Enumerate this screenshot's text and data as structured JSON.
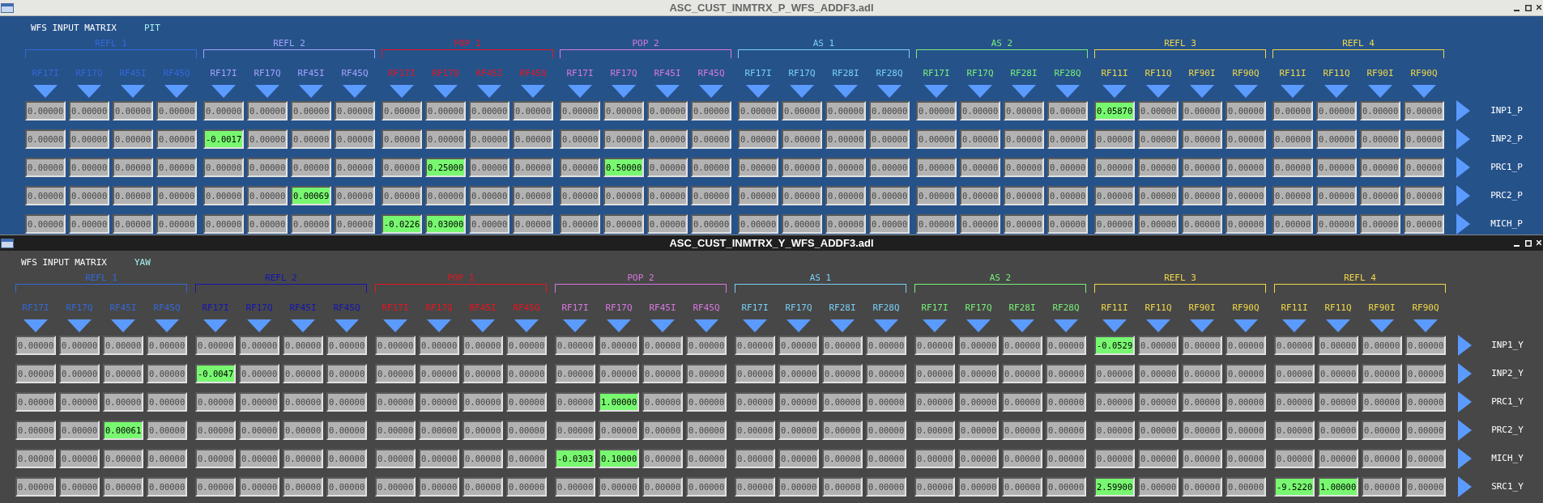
{
  "windows": [
    {
      "title": "ASC_CUST_INMTRX_P_WFS_ADDF3.adl",
      "heading": "WFS INPUT MATRIX",
      "mode": "PIT",
      "groups": [
        {
          "name": "REFL 1",
          "color": "#3468d8",
          "channels": [
            "RF17I",
            "RF17Q",
            "RF45I",
            "RF45Q"
          ]
        },
        {
          "name": "REFL 2",
          "color": "#a4a4ff",
          "channels": [
            "RF17I",
            "RF17Q",
            "RF45I",
            "RF45Q"
          ]
        },
        {
          "name": "POP 1",
          "color": "#e81420",
          "channels": [
            "RF17I",
            "RF17Q",
            "RF45I",
            "RF45Q"
          ]
        },
        {
          "name": "POP 2",
          "color": "#d878e0",
          "channels": [
            "RF17I",
            "RF17Q",
            "RF45I",
            "RF45Q"
          ]
        },
        {
          "name": "AS 1",
          "color": "#78d0f8",
          "channels": [
            "RF17I",
            "RF17Q",
            "RF28I",
            "RF28Q"
          ]
        },
        {
          "name": "AS 2",
          "color": "#78f078",
          "channels": [
            "RF17I",
            "RF17Q",
            "RF28I",
            "RF28Q"
          ]
        },
        {
          "name": "REFL 3",
          "color": "#f0d848",
          "channels": [
            "RF11I",
            "RF11Q",
            "RF90I",
            "RF90Q"
          ]
        },
        {
          "name": "REFL 4",
          "color": "#f0d848",
          "channels": [
            "RF11I",
            "RF11Q",
            "RF90I",
            "RF90Q"
          ]
        }
      ],
      "rows": [
        {
          "label": "INP1_P",
          "cells": [
            {
              "value": "0.00000",
              "on": false
            },
            {
              "value": "0.00000",
              "on": false
            },
            {
              "value": "0.00000",
              "on": false
            },
            {
              "value": "0.00000",
              "on": false
            },
            {
              "value": "0.00000",
              "on": false
            },
            {
              "value": "0.00000",
              "on": false
            },
            {
              "value": "0.00000",
              "on": false
            },
            {
              "value": "0.00000",
              "on": false
            },
            {
              "value": "0.00000",
              "on": false
            },
            {
              "value": "0.00000",
              "on": false
            },
            {
              "value": "0.00000",
              "on": false
            },
            {
              "value": "0.00000",
              "on": false
            },
            {
              "value": "0.00000",
              "on": false
            },
            {
              "value": "0.00000",
              "on": false
            },
            {
              "value": "0.00000",
              "on": false
            },
            {
              "value": "0.00000",
              "on": false
            },
            {
              "value": "0.00000",
              "on": false
            },
            {
              "value": "0.00000",
              "on": false
            },
            {
              "value": "0.00000",
              "on": false
            },
            {
              "value": "0.00000",
              "on": false
            },
            {
              "value": "0.00000",
              "on": false
            },
            {
              "value": "0.00000",
              "on": false
            },
            {
              "value": "0.00000",
              "on": false
            },
            {
              "value": "0.00000",
              "on": false
            },
            {
              "value": "0.05870",
              "on": true
            },
            {
              "value": "0.00000",
              "on": false
            },
            {
              "value": "0.00000",
              "on": false
            },
            {
              "value": "0.00000",
              "on": false
            },
            {
              "value": "0.00000",
              "on": false
            },
            {
              "value": "0.00000",
              "on": false
            },
            {
              "value": "0.00000",
              "on": false
            },
            {
              "value": "0.00000",
              "on": false
            }
          ]
        },
        {
          "label": "INP2_P",
          "cells": [
            {
              "value": "0.00000",
              "on": false
            },
            {
              "value": "0.00000",
              "on": false
            },
            {
              "value": "0.00000",
              "on": false
            },
            {
              "value": "0.00000",
              "on": false
            },
            {
              "value": "-0.0017",
              "on": true
            },
            {
              "value": "0.00000",
              "on": false
            },
            {
              "value": "0.00000",
              "on": false
            },
            {
              "value": "0.00000",
              "on": false
            },
            {
              "value": "0.00000",
              "on": false
            },
            {
              "value": "0.00000",
              "on": false
            },
            {
              "value": "0.00000",
              "on": false
            },
            {
              "value": "0.00000",
              "on": false
            },
            {
              "value": "0.00000",
              "on": false
            },
            {
              "value": "0.00000",
              "on": false
            },
            {
              "value": "0.00000",
              "on": false
            },
            {
              "value": "0.00000",
              "on": false
            },
            {
              "value": "0.00000",
              "on": false
            },
            {
              "value": "0.00000",
              "on": false
            },
            {
              "value": "0.00000",
              "on": false
            },
            {
              "value": "0.00000",
              "on": false
            },
            {
              "value": "0.00000",
              "on": false
            },
            {
              "value": "0.00000",
              "on": false
            },
            {
              "value": "0.00000",
              "on": false
            },
            {
              "value": "0.00000",
              "on": false
            },
            {
              "value": "0.00000",
              "on": false
            },
            {
              "value": "0.00000",
              "on": false
            },
            {
              "value": "0.00000",
              "on": false
            },
            {
              "value": "0.00000",
              "on": false
            },
            {
              "value": "0.00000",
              "on": false
            },
            {
              "value": "0.00000",
              "on": false
            },
            {
              "value": "0.00000",
              "on": false
            },
            {
              "value": "0.00000",
              "on": false
            }
          ]
        },
        {
          "label": "PRC1_P",
          "cells": [
            {
              "value": "0.00000",
              "on": false
            },
            {
              "value": "0.00000",
              "on": false
            },
            {
              "value": "0.00000",
              "on": false
            },
            {
              "value": "0.00000",
              "on": false
            },
            {
              "value": "0.00000",
              "on": false
            },
            {
              "value": "0.00000",
              "on": false
            },
            {
              "value": "0.00000",
              "on": false
            },
            {
              "value": "0.00000",
              "on": false
            },
            {
              "value": "0.00000",
              "on": false
            },
            {
              "value": "0.25000",
              "on": true
            },
            {
              "value": "0.00000",
              "on": false
            },
            {
              "value": "0.00000",
              "on": false
            },
            {
              "value": "0.00000",
              "on": false
            },
            {
              "value": "0.50000",
              "on": true
            },
            {
              "value": "0.00000",
              "on": false
            },
            {
              "value": "0.00000",
              "on": false
            },
            {
              "value": "0.00000",
              "on": false
            },
            {
              "value": "0.00000",
              "on": false
            },
            {
              "value": "0.00000",
              "on": false
            },
            {
              "value": "0.00000",
              "on": false
            },
            {
              "value": "0.00000",
              "on": false
            },
            {
              "value": "0.00000",
              "on": false
            },
            {
              "value": "0.00000",
              "on": false
            },
            {
              "value": "0.00000",
              "on": false
            },
            {
              "value": "0.00000",
              "on": false
            },
            {
              "value": "0.00000",
              "on": false
            },
            {
              "value": "0.00000",
              "on": false
            },
            {
              "value": "0.00000",
              "on": false
            },
            {
              "value": "0.00000",
              "on": false
            },
            {
              "value": "0.00000",
              "on": false
            },
            {
              "value": "0.00000",
              "on": false
            },
            {
              "value": "0.00000",
              "on": false
            }
          ]
        },
        {
          "label": "PRC2_P",
          "cells": [
            {
              "value": "0.00000",
              "on": false
            },
            {
              "value": "0.00000",
              "on": false
            },
            {
              "value": "0.00000",
              "on": false
            },
            {
              "value": "0.00000",
              "on": false
            },
            {
              "value": "0.00000",
              "on": false
            },
            {
              "value": "0.00000",
              "on": false
            },
            {
              "value": "0.00069",
              "on": true
            },
            {
              "value": "0.00000",
              "on": false
            },
            {
              "value": "0.00000",
              "on": false
            },
            {
              "value": "0.00000",
              "on": false
            },
            {
              "value": "0.00000",
              "on": false
            },
            {
              "value": "0.00000",
              "on": false
            },
            {
              "value": "0.00000",
              "on": false
            },
            {
              "value": "0.00000",
              "on": false
            },
            {
              "value": "0.00000",
              "on": false
            },
            {
              "value": "0.00000",
              "on": false
            },
            {
              "value": "0.00000",
              "on": false
            },
            {
              "value": "0.00000",
              "on": false
            },
            {
              "value": "0.00000",
              "on": false
            },
            {
              "value": "0.00000",
              "on": false
            },
            {
              "value": "0.00000",
              "on": false
            },
            {
              "value": "0.00000",
              "on": false
            },
            {
              "value": "0.00000",
              "on": false
            },
            {
              "value": "0.00000",
              "on": false
            },
            {
              "value": "0.00000",
              "on": false
            },
            {
              "value": "0.00000",
              "on": false
            },
            {
              "value": "0.00000",
              "on": false
            },
            {
              "value": "0.00000",
              "on": false
            },
            {
              "value": "0.00000",
              "on": false
            },
            {
              "value": "0.00000",
              "on": false
            },
            {
              "value": "0.00000",
              "on": false
            },
            {
              "value": "0.00000",
              "on": false
            }
          ]
        },
        {
          "label": "MICH_P",
          "cells": [
            {
              "value": "0.00000",
              "on": false
            },
            {
              "value": "0.00000",
              "on": false
            },
            {
              "value": "0.00000",
              "on": false
            },
            {
              "value": "0.00000",
              "on": false
            },
            {
              "value": "0.00000",
              "on": false
            },
            {
              "value": "0.00000",
              "on": false
            },
            {
              "value": "0.00000",
              "on": false
            },
            {
              "value": "0.00000",
              "on": false
            },
            {
              "value": "-0.0226",
              "on": true
            },
            {
              "value": "0.03000",
              "on": true
            },
            {
              "value": "0.00000",
              "on": false
            },
            {
              "value": "0.00000",
              "on": false
            },
            {
              "value": "0.00000",
              "on": false
            },
            {
              "value": "0.00000",
              "on": false
            },
            {
              "value": "0.00000",
              "on": false
            },
            {
              "value": "0.00000",
              "on": false
            },
            {
              "value": "0.00000",
              "on": false
            },
            {
              "value": "0.00000",
              "on": false
            },
            {
              "value": "0.00000",
              "on": false
            },
            {
              "value": "0.00000",
              "on": false
            },
            {
              "value": "0.00000",
              "on": false
            },
            {
              "value": "0.00000",
              "on": false
            },
            {
              "value": "0.00000",
              "on": false
            },
            {
              "value": "0.00000",
              "on": false
            },
            {
              "value": "0.00000",
              "on": false
            },
            {
              "value": "0.00000",
              "on": false
            },
            {
              "value": "0.00000",
              "on": false
            },
            {
              "value": "0.00000",
              "on": false
            },
            {
              "value": "0.00000",
              "on": false
            },
            {
              "value": "0.00000",
              "on": false
            },
            {
              "value": "0.00000",
              "on": false
            },
            {
              "value": "0.00000",
              "on": false
            }
          ]
        }
      ]
    },
    {
      "title": "ASC_CUST_INMTRX_Y_WFS_ADDF3.adl",
      "heading": "WFS INPUT MATRIX",
      "mode": "YAW",
      "groups": [
        {
          "name": "REFL 1",
          "color": "#3468d8",
          "channels": [
            "RF17I",
            "RF17Q",
            "RF45I",
            "RF45Q"
          ]
        },
        {
          "name": "REFL 2",
          "color": "#1414b4",
          "channels": [
            "RF17I",
            "RF17Q",
            "RF45I",
            "RF45Q"
          ]
        },
        {
          "name": "POP 1",
          "color": "#e81420",
          "channels": [
            "RF17I",
            "RF17Q",
            "RF45I",
            "RF45Q"
          ]
        },
        {
          "name": "POP 2",
          "color": "#d878e0",
          "channels": [
            "RF17I",
            "RF17Q",
            "RF45I",
            "RF45Q"
          ]
        },
        {
          "name": "AS 1",
          "color": "#78d0f8",
          "channels": [
            "RF17I",
            "RF17Q",
            "RF28I",
            "RF28Q"
          ]
        },
        {
          "name": "AS 2",
          "color": "#78f078",
          "channels": [
            "RF17I",
            "RF17Q",
            "RF28I",
            "RF28Q"
          ]
        },
        {
          "name": "REFL 3",
          "color": "#f0d848",
          "channels": [
            "RF11I",
            "RF11Q",
            "RF90I",
            "RF90Q"
          ]
        },
        {
          "name": "REFL 4",
          "color": "#f0d848",
          "channels": [
            "RF11I",
            "RF11Q",
            "RF90I",
            "RF90Q"
          ]
        }
      ],
      "rows": [
        {
          "label": "INP1_Y",
          "cells": [
            {
              "value": "0.00000",
              "on": false
            },
            {
              "value": "0.00000",
              "on": false
            },
            {
              "value": "0.00000",
              "on": false
            },
            {
              "value": "0.00000",
              "on": false
            },
            {
              "value": "0.00000",
              "on": false
            },
            {
              "value": "0.00000",
              "on": false
            },
            {
              "value": "0.00000",
              "on": false
            },
            {
              "value": "0.00000",
              "on": false
            },
            {
              "value": "0.00000",
              "on": false
            },
            {
              "value": "0.00000",
              "on": false
            },
            {
              "value": "0.00000",
              "on": false
            },
            {
              "value": "0.00000",
              "on": false
            },
            {
              "value": "0.00000",
              "on": false
            },
            {
              "value": "0.00000",
              "on": false
            },
            {
              "value": "0.00000",
              "on": false
            },
            {
              "value": "0.00000",
              "on": false
            },
            {
              "value": "0.00000",
              "on": false
            },
            {
              "value": "0.00000",
              "on": false
            },
            {
              "value": "0.00000",
              "on": false
            },
            {
              "value": "0.00000",
              "on": false
            },
            {
              "value": "0.00000",
              "on": false
            },
            {
              "value": "0.00000",
              "on": false
            },
            {
              "value": "0.00000",
              "on": false
            },
            {
              "value": "0.00000",
              "on": false
            },
            {
              "value": "-0.0529",
              "on": true
            },
            {
              "value": "0.00000",
              "on": false
            },
            {
              "value": "0.00000",
              "on": false
            },
            {
              "value": "0.00000",
              "on": false
            },
            {
              "value": "0.00000",
              "on": false
            },
            {
              "value": "0.00000",
              "on": false
            },
            {
              "value": "0.00000",
              "on": false
            },
            {
              "value": "0.00000",
              "on": false
            }
          ]
        },
        {
          "label": "INP2_Y",
          "cells": [
            {
              "value": "0.00000",
              "on": false
            },
            {
              "value": "0.00000",
              "on": false
            },
            {
              "value": "0.00000",
              "on": false
            },
            {
              "value": "0.00000",
              "on": false
            },
            {
              "value": "-0.0047",
              "on": true
            },
            {
              "value": "0.00000",
              "on": false
            },
            {
              "value": "0.00000",
              "on": false
            },
            {
              "value": "0.00000",
              "on": false
            },
            {
              "value": "0.00000",
              "on": false
            },
            {
              "value": "0.00000",
              "on": false
            },
            {
              "value": "0.00000",
              "on": false
            },
            {
              "value": "0.00000",
              "on": false
            },
            {
              "value": "0.00000",
              "on": false
            },
            {
              "value": "0.00000",
              "on": false
            },
            {
              "value": "0.00000",
              "on": false
            },
            {
              "value": "0.00000",
              "on": false
            },
            {
              "value": "0.00000",
              "on": false
            },
            {
              "value": "0.00000",
              "on": false
            },
            {
              "value": "0.00000",
              "on": false
            },
            {
              "value": "0.00000",
              "on": false
            },
            {
              "value": "0.00000",
              "on": false
            },
            {
              "value": "0.00000",
              "on": false
            },
            {
              "value": "0.00000",
              "on": false
            },
            {
              "value": "0.00000",
              "on": false
            },
            {
              "value": "0.00000",
              "on": false
            },
            {
              "value": "0.00000",
              "on": false
            },
            {
              "value": "0.00000",
              "on": false
            },
            {
              "value": "0.00000",
              "on": false
            },
            {
              "value": "0.00000",
              "on": false
            },
            {
              "value": "0.00000",
              "on": false
            },
            {
              "value": "0.00000",
              "on": false
            },
            {
              "value": "0.00000",
              "on": false
            }
          ]
        },
        {
          "label": "PRC1_Y",
          "cells": [
            {
              "value": "0.00000",
              "on": false
            },
            {
              "value": "0.00000",
              "on": false
            },
            {
              "value": "0.00000",
              "on": false
            },
            {
              "value": "0.00000",
              "on": false
            },
            {
              "value": "0.00000",
              "on": false
            },
            {
              "value": "0.00000",
              "on": false
            },
            {
              "value": "0.00000",
              "on": false
            },
            {
              "value": "0.00000",
              "on": false
            },
            {
              "value": "0.00000",
              "on": false
            },
            {
              "value": "0.00000",
              "on": false
            },
            {
              "value": "0.00000",
              "on": false
            },
            {
              "value": "0.00000",
              "on": false
            },
            {
              "value": "0.00000",
              "on": false
            },
            {
              "value": "1.00000",
              "on": true
            },
            {
              "value": "0.00000",
              "on": false
            },
            {
              "value": "0.00000",
              "on": false
            },
            {
              "value": "0.00000",
              "on": false
            },
            {
              "value": "0.00000",
              "on": false
            },
            {
              "value": "0.00000",
              "on": false
            },
            {
              "value": "0.00000",
              "on": false
            },
            {
              "value": "0.00000",
              "on": false
            },
            {
              "value": "0.00000",
              "on": false
            },
            {
              "value": "0.00000",
              "on": false
            },
            {
              "value": "0.00000",
              "on": false
            },
            {
              "value": "0.00000",
              "on": false
            },
            {
              "value": "0.00000",
              "on": false
            },
            {
              "value": "0.00000",
              "on": false
            },
            {
              "value": "0.00000",
              "on": false
            },
            {
              "value": "0.00000",
              "on": false
            },
            {
              "value": "0.00000",
              "on": false
            },
            {
              "value": "0.00000",
              "on": false
            },
            {
              "value": "0.00000",
              "on": false
            }
          ]
        },
        {
          "label": "PRC2_Y",
          "cells": [
            {
              "value": "0.00000",
              "on": false
            },
            {
              "value": "0.00000",
              "on": false
            },
            {
              "value": "0.00061",
              "on": true
            },
            {
              "value": "0.00000",
              "on": false
            },
            {
              "value": "0.00000",
              "on": false
            },
            {
              "value": "0.00000",
              "on": false
            },
            {
              "value": "0.00000",
              "on": false
            },
            {
              "value": "0.00000",
              "on": false
            },
            {
              "value": "0.00000",
              "on": false
            },
            {
              "value": "0.00000",
              "on": false
            },
            {
              "value": "0.00000",
              "on": false
            },
            {
              "value": "0.00000",
              "on": false
            },
            {
              "value": "0.00000",
              "on": false
            },
            {
              "value": "0.00000",
              "on": false
            },
            {
              "value": "0.00000",
              "on": false
            },
            {
              "value": "0.00000",
              "on": false
            },
            {
              "value": "0.00000",
              "on": false
            },
            {
              "value": "0.00000",
              "on": false
            },
            {
              "value": "0.00000",
              "on": false
            },
            {
              "value": "0.00000",
              "on": false
            },
            {
              "value": "0.00000",
              "on": false
            },
            {
              "value": "0.00000",
              "on": false
            },
            {
              "value": "0.00000",
              "on": false
            },
            {
              "value": "0.00000",
              "on": false
            },
            {
              "value": "0.00000",
              "on": false
            },
            {
              "value": "0.00000",
              "on": false
            },
            {
              "value": "0.00000",
              "on": false
            },
            {
              "value": "0.00000",
              "on": false
            },
            {
              "value": "0.00000",
              "on": false
            },
            {
              "value": "0.00000",
              "on": false
            },
            {
              "value": "0.00000",
              "on": false
            },
            {
              "value": "0.00000",
              "on": false
            }
          ]
        },
        {
          "label": "MICH_Y",
          "cells": [
            {
              "value": "0.00000",
              "on": false
            },
            {
              "value": "0.00000",
              "on": false
            },
            {
              "value": "0.00000",
              "on": false
            },
            {
              "value": "0.00000",
              "on": false
            },
            {
              "value": "0.00000",
              "on": false
            },
            {
              "value": "0.00000",
              "on": false
            },
            {
              "value": "0.00000",
              "on": false
            },
            {
              "value": "0.00000",
              "on": false
            },
            {
              "value": "0.00000",
              "on": false
            },
            {
              "value": "0.00000",
              "on": false
            },
            {
              "value": "0.00000",
              "on": false
            },
            {
              "value": "0.00000",
              "on": false
            },
            {
              "value": "-0.0303",
              "on": true
            },
            {
              "value": "0.10000",
              "on": true
            },
            {
              "value": "0.00000",
              "on": false
            },
            {
              "value": "0.00000",
              "on": false
            },
            {
              "value": "0.00000",
              "on": false
            },
            {
              "value": "0.00000",
              "on": false
            },
            {
              "value": "0.00000",
              "on": false
            },
            {
              "value": "0.00000",
              "on": false
            },
            {
              "value": "0.00000",
              "on": false
            },
            {
              "value": "0.00000",
              "on": false
            },
            {
              "value": "0.00000",
              "on": false
            },
            {
              "value": "0.00000",
              "on": false
            },
            {
              "value": "0.00000",
              "on": false
            },
            {
              "value": "0.00000",
              "on": false
            },
            {
              "value": "0.00000",
              "on": false
            },
            {
              "value": "0.00000",
              "on": false
            },
            {
              "value": "0.00000",
              "on": false
            },
            {
              "value": "0.00000",
              "on": false
            },
            {
              "value": "0.00000",
              "on": false
            },
            {
              "value": "0.00000",
              "on": false
            }
          ]
        },
        {
          "label": "SRC1_Y",
          "cells": [
            {
              "value": "0.00000",
              "on": false
            },
            {
              "value": "0.00000",
              "on": false
            },
            {
              "value": "0.00000",
              "on": false
            },
            {
              "value": "0.00000",
              "on": false
            },
            {
              "value": "0.00000",
              "on": false
            },
            {
              "value": "0.00000",
              "on": false
            },
            {
              "value": "0.00000",
              "on": false
            },
            {
              "value": "0.00000",
              "on": false
            },
            {
              "value": "0.00000",
              "on": false
            },
            {
              "value": "0.00000",
              "on": false
            },
            {
              "value": "0.00000",
              "on": false
            },
            {
              "value": "0.00000",
              "on": false
            },
            {
              "value": "0.00000",
              "on": false
            },
            {
              "value": "0.00000",
              "on": false
            },
            {
              "value": "0.00000",
              "on": false
            },
            {
              "value": "0.00000",
              "on": false
            },
            {
              "value": "0.00000",
              "on": false
            },
            {
              "value": "0.00000",
              "on": false
            },
            {
              "value": "0.00000",
              "on": false
            },
            {
              "value": "0.00000",
              "on": false
            },
            {
              "value": "0.00000",
              "on": false
            },
            {
              "value": "0.00000",
              "on": false
            },
            {
              "value": "0.00000",
              "on": false
            },
            {
              "value": "0.00000",
              "on": false
            },
            {
              "value": "2.59900",
              "on": true
            },
            {
              "value": "0.00000",
              "on": false
            },
            {
              "value": "0.00000",
              "on": false
            },
            {
              "value": "0.00000",
              "on": false
            },
            {
              "value": "-9.5220",
              "on": true
            },
            {
              "value": "1.00000",
              "on": true
            },
            {
              "value": "0.00000",
              "on": false
            },
            {
              "value": "0.00000",
              "on": false
            }
          ]
        }
      ]
    }
  ]
}
